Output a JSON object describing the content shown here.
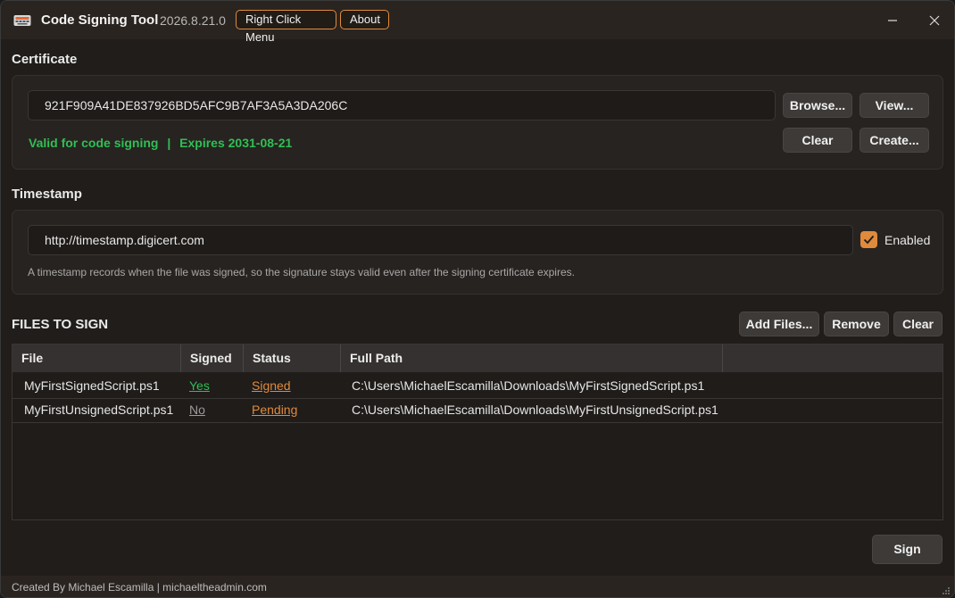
{
  "titlebar": {
    "app_title": "Code Signing Tool",
    "version": "2026.8.21.0",
    "right_click_menu_label": "Right Click Menu",
    "about_label": "About",
    "accent": "#e08a3c"
  },
  "certificate": {
    "section_title": "Certificate",
    "thumbprint": "921F909A41DE837926BD5AFC9B7AF3A5A3DA206C",
    "status_valid": "Valid for code signing",
    "separator": "|",
    "expires": "Expires 2031-08-21",
    "status_color": "#2fbf55",
    "browse_label": "Browse...",
    "view_label": "View...",
    "clear_label": "Clear",
    "create_label": "Create..."
  },
  "timestamp": {
    "section_title": "Timestamp",
    "url": "http://timestamp.digicert.com",
    "enabled_label": "Enabled",
    "enabled": true,
    "hint": "A timestamp records when the file was signed, so the signature stays valid even after the signing certificate expires."
  },
  "files": {
    "section_title": "FILES TO SIGN",
    "add_label": "Add Files...",
    "remove_label": "Remove",
    "clear_label": "Clear",
    "columns": [
      "File",
      "Signed",
      "Status",
      "Full Path"
    ],
    "rows": [
      {
        "file": "MyFirstSignedScript.ps1",
        "signed": "Yes",
        "status": "Signed",
        "path": "C:\\Users\\MichaelEscamilla\\Downloads\\MyFirstSignedScript.ps1"
      },
      {
        "file": "MyFirstUnsignedScript.ps1",
        "signed": "No",
        "status": "Pending",
        "path": "C:\\Users\\MichaelEscamilla\\Downloads\\MyFirstUnsignedScript.ps1"
      }
    ]
  },
  "actions": {
    "sign_label": "Sign"
  },
  "footer": {
    "text": "Created By Michael Escamilla | michaeltheadmin.com"
  }
}
